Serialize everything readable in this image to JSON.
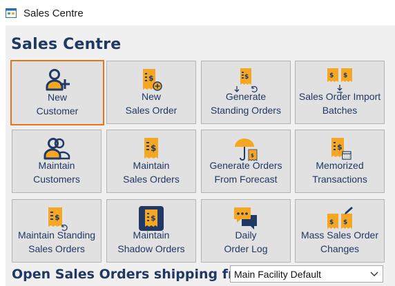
{
  "window": {
    "title": "Sales Centre"
  },
  "page": {
    "title": "Sales Centre"
  },
  "tiles": [
    {
      "label": "New\nCustomer",
      "icon": "new-customer-icon"
    },
    {
      "label": "New\nSales Order",
      "icon": "new-sales-order-icon"
    },
    {
      "label": "Generate\nStanding Orders",
      "icon": "generate-standing-orders-icon"
    },
    {
      "label": "Sales Order Import\nBatches",
      "icon": "import-batches-icon"
    },
    {
      "label": "Maintain\nCustomers",
      "icon": "maintain-customers-icon"
    },
    {
      "label": "Maintain\nSales Orders",
      "icon": "maintain-sales-orders-icon"
    },
    {
      "label": "Generate Orders\nFrom Forecast",
      "icon": "forecast-icon"
    },
    {
      "label": "Memorized\nTransactions",
      "icon": "memorized-transactions-icon"
    },
    {
      "label": "Maintain Standing\nSales Orders",
      "icon": "maintain-standing-orders-icon"
    },
    {
      "label": "Maintain\nShadow Orders",
      "icon": "shadow-orders-icon"
    },
    {
      "label": "Daily\nOrder Log",
      "icon": "order-log-icon"
    },
    {
      "label": "Mass Sales Order\nChanges",
      "icon": "mass-changes-icon"
    }
  ],
  "footer": {
    "label": "Open Sales Orders shipping from",
    "facility_select": "Main Facility Default"
  },
  "colors": {
    "accent": "#f5a623",
    "navy": "#1f3864",
    "selected_border": "#e8731e"
  }
}
